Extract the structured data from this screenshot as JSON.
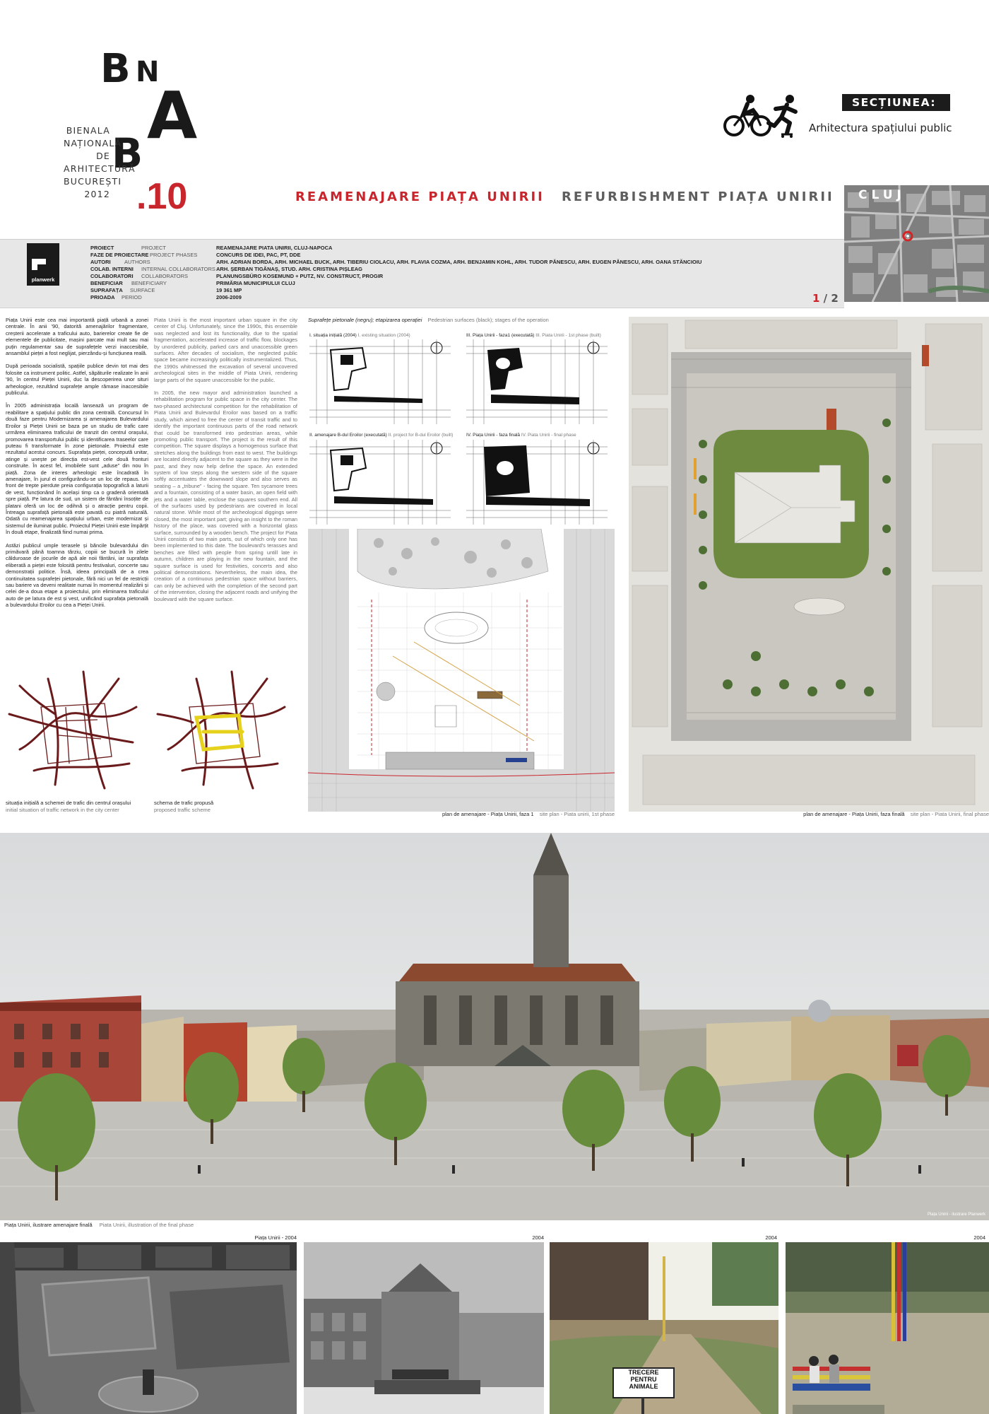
{
  "header": {
    "logo_letters": [
      "B",
      "N",
      "A",
      "B"
    ],
    "biennale_lines": [
      "BIENALA",
      "NAȚIONALĂ",
      "DE",
      "ARHITECTURĂ",
      "BUCUREȘTI",
      "2012"
    ],
    "edition": ".10",
    "title_ro": "REAMENAJARE PIAȚA UNIRII",
    "title_en": "REFURBISHMENT PIAȚA UNIRII",
    "section_label": "SECȚIUNEA:",
    "section_name": "Arhitectura spațiului public",
    "section_icon": "cyclist-and-skater-icon",
    "map_city": "CLUJ",
    "page_current": "1",
    "page_sep": " / ",
    "page_total": "2"
  },
  "office_logo": "planwerk",
  "project_info": [
    {
      "ro": "PROIECT",
      "en": "PROJECT",
      "value": "REAMENAJARE PIATA UNIRII, CLUJ-NAPOCA"
    },
    {
      "ro": "FAZE DE PROIECTARE",
      "en": "PROJECT PHASES",
      "value": "CONCURS DE IDEI, PAC, PT, DDE"
    },
    {
      "ro": "AUTORI",
      "en": "AUTHORS",
      "value": "ARH. ADRIAN BORDA, ARH. MICHAEL BUCK, ARH. TIBERIU CIOLACU, ARH. FLAVIA COZMA, ARH. BENJAMIN KOHL, ARH. TUDOR PĂNESCU, ARH. EUGEN PĂNESCU, ARH. OANA STĂNCIOIU"
    },
    {
      "ro": "COLAB. INTERNI",
      "en": "INTERNAL COLLABORATORS",
      "value": "ARH. ȘERBAN TIGĂNAȘ, STUD. ARH. CRISTINA PIȘLEAG"
    },
    {
      "ro": "COLABORATORI",
      "en": "COLLABORATORS",
      "value": "PLANUNGSBÜRO KOSEMUND + PUTZ, NV. CONSTRUCT, PROGIR"
    },
    {
      "ro": "BENEFICIAR",
      "en": "BENEFICIARY",
      "value": "PRIMĂRIA MUNICIPIULUI CLUJ"
    },
    {
      "ro": "SUPRAFAȚA",
      "en": "SURFACE",
      "value": "19 361 MP"
    },
    {
      "ro": "PRIOADA",
      "en": "PERIOD",
      "value": "2006-2009"
    }
  ],
  "text_ro": [
    "Piața Unirii este cea mai importantă piață urbană a zonei centrale. În anii '90, datorită amenajărilor fragmentare, creșterii accelerate a traficului auto, barierelor create fie de elementele de publicitate, mașini parcate mai mult sau mai puțin regulamentar sau de suprafețele verzi inaccesibile, ansamblul pieței a fost neglijat, pierzându-și funcțiunea reală.",
    "După perioada socialistă, spațiile publice devin tot mai des folosite ca instrument politic. Astfel, săpăturile realizate în anii '90, în centrul Pieței Unirii, duc la descoperirea unor situri arheologice, rezultând suprafețe ample rămase inaccesibile publicului.",
    "În 2005 administrația locală lansează un program de reabilitare a spațiului public din zona centrală. Concursul în două faze pentru Modernizarea și amenajarea Bulevardului Eroilor și Pieței Unirii se baza pe un studiu de trafic care urmărea eliminarea traficului de tranzit din centrul orașului, promovarea transportului public și identificarea traseelor care puteau fi transformate în zone pietonale. Proiectul este rezultatul acestui concurs. Suprafața pieței, concepută unitar, atinge și unește pe direcția est-vest cele două fronturi construite. În acest fel, imobilele sunt „aduse” din nou în piață. Zona de interes arheologic este încadrată în amenajare, în jurul ei configurându-se un loc de repaus. Un front de trepte pierdute preia configurația topografică a laturii de vest, funcționând în același timp ca o gradenă orientată spre piață. Pe latura de sud, un sistem de fântâni însoțite de platani oferă un loc de odihnă și o atracție pentru copii. Întreaga suprafață pietonală este pavată cu piatră naturală. Odată cu reamenajarea spațiului urban, este modernizat și sistemul de iluminat public. Proiectul Pieței Unirii este împărțit în două etape, finalizată fiind numai prima.",
    "Astăzi publicul umple terasele și băncile bulevardului din primăvară până toamna târziu, copiii se bucură în zilele călduroase de jocurile de apă ale noii fântâni, iar suprafața eliberată a pieței este folosită pentru festivaluri, concerte sau demonstrații politice. Însă, ideea principală de a crea continuitatea suprafeței pietonale, fără nici un fel de restricții sau bariere va deveni realitate numai în momentul realizării și celei de-a doua etape a proiectului, prin eliminarea traficului auto de pe latura de est și vest, unificând suprafața pietonală a bulevardului Eroilor cu cea a Pieței Unirii."
  ],
  "text_en": [
    "Piata Unirii is the most important urban square in the city center of Cluj. Unfortunately, since the 1990s, this ensemble was neglected and lost its functionality, due to the spatial fragmentation, accelerated increase of traffic flow, blockages by unordered publicity, parked cars and unaccessible green surfaces. After decades of socialism, the neglected public space became increasingly politically instrumentalized. Thus, the 1990s whitnessed the excavation of several uncovered archeological sites in the middle of Piata Unirii, rendering large parts of the square unaccessible for the public.",
    "In 2005, the new mayor and administration launched a rehabilitation program for public space in the city center. The two-phased architectural competition for the rehabilitation of Piata Unirii and Bulevardul Eroilor was based on a traffic study, which aimed to free the center of transit traffic and to identify the important continuous parts of the road network that could be transformed into pedestrian areas, while promoting public transport. The project is the result of this competition. The square displays a homogenous surface that stretches along the buildings from east to west. The buildings are located directly adjacent to the square as they were in the past, and they now help define the space. An extended system of low steps along the western side of the square softly accentuates the downward slope and also serves as seating – a „tribune” - facing the square. Ten sycamore trees and a fountain, consisting of a water basin, an open field with jets and a water table, enclose the squares southern end. All of the surfaces used by pedestrians are covered in local natural stone. While most of the archeological diggings were closed, the most important part; giving an insight to the roman history of the place, was covered with a horizontal glass surface, surrounded by a wooden bench. The project for Piata Unirii consists of two main parts, out of which only one has been implemented to this date. The boulevard's terasses and benches are filled with people from spring untill late in autumn, children are playing in the new fountain, and the square surface is used for festivities, concerts and also political demonstrations. Nevertheless, the main idea, the creation of a continuous pedestrian space without barriers, can only be achieved with the completion of the second part of the intervention, closing the adjacent roads and unifying the boulevard with the square surface."
  ],
  "traffic_captions": [
    {
      "ro": "situația inițială a schemei de trafic din centrul orașului",
      "en": "initial situation of traffic network in the city center"
    },
    {
      "ro": "schema de trafic propusă",
      "en": "proposed traffic scheme"
    }
  ],
  "phases_heading": {
    "ro": "Suprafețe pietonale (negru); etapizarea operației",
    "en": "Pedestrian surfaces (black); stages of the operation"
  },
  "phases": [
    {
      "ro": "I. situația inițială (2004)",
      "en": "I. existing situation (2004)"
    },
    {
      "ro": "III. Piața Unirii - faza1 (executată)",
      "en": "III. Piata Unirii - 1st phase (built)"
    },
    {
      "ro": "II. amenajare B-dul Eroilor (executată)",
      "en": "II. project for B-dul Eroilor (built)"
    },
    {
      "ro": "IV. Piața Unirii - faza finală",
      "en": "IV. Piata Unirii - final phase"
    }
  ],
  "plan_captions": [
    {
      "ro": "plan de amenajare - Piața Unirii, faza 1",
      "en": "site plan - Piata unirii, 1st phase"
    },
    {
      "ro": "plan de amenajare - Piața Unirii, faza finală",
      "en": "site plan - Piata Unirii, final phase"
    }
  ],
  "rendering": {
    "caption_ro": "Piața Unirii, ilustrare amenajare finală",
    "caption_en": "Piata Unirii, illustration of the final phase",
    "credit": "Piața Unirii - ilustrare Planwerk"
  },
  "photos": [
    {
      "label": "Piața Unirii - 2004"
    },
    {
      "label": "2004"
    },
    {
      "label": "2004",
      "sign": [
        "TRECERE",
        "PENTRU",
        "ANIMALE"
      ]
    },
    {
      "label": "2004"
    }
  ]
}
